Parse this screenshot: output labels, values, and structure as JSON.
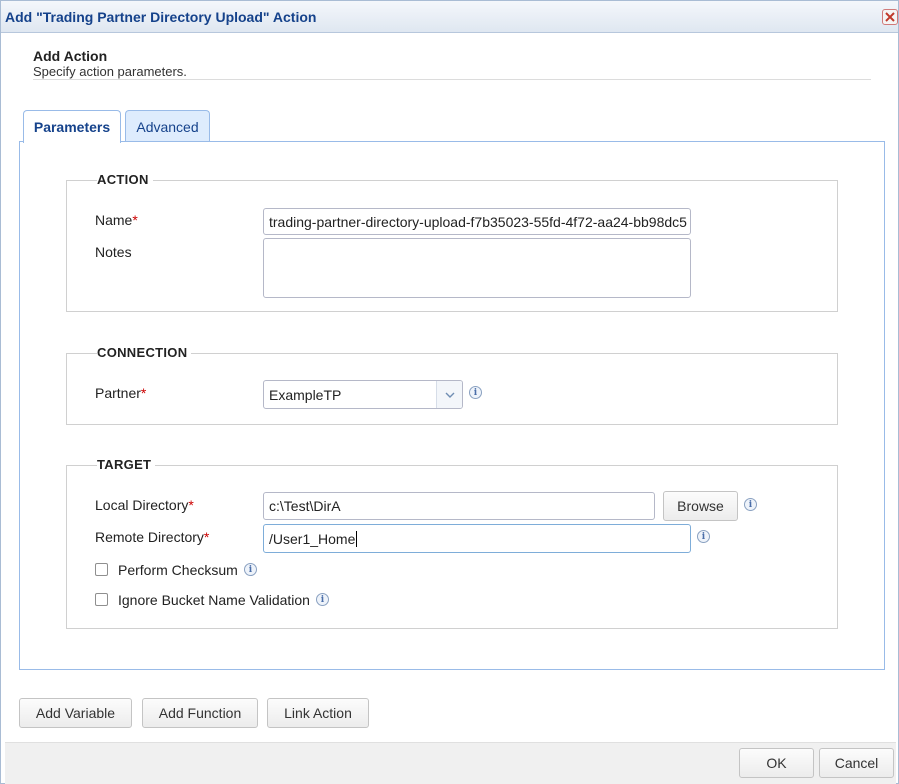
{
  "window": {
    "title": "Add \"Trading Partner Directory Upload\" Action",
    "close_label": "×"
  },
  "header": {
    "title": "Add Action",
    "subtitle": "Specify action parameters."
  },
  "tabs": [
    {
      "label": "Parameters",
      "active": true
    },
    {
      "label": "Advanced",
      "active": false
    }
  ],
  "action_group": {
    "legend": "ACTION",
    "name_label": "Name",
    "name_value": "trading-partner-directory-upload-f7b35023-55fd-4f72-aa24-bb98dc5",
    "notes_label": "Notes",
    "notes_value": ""
  },
  "connection_group": {
    "legend": "CONNECTION",
    "partner_label": "Partner",
    "partner_value": "ExampleTP"
  },
  "target_group": {
    "legend": "TARGET",
    "local_dir_label": "Local Directory",
    "local_dir_value": "c:\\Test\\DirA",
    "browse_label": "Browse",
    "remote_dir_label": "Remote Directory",
    "remote_dir_value": "/User1_Home",
    "checksum_label": "Perform Checksum",
    "checksum_checked": false,
    "ignore_bucket_label": "Ignore Bucket Name Validation",
    "ignore_bucket_checked": false
  },
  "required_marker": "*",
  "info_icon": "i",
  "bottom_buttons": {
    "add_variable": "Add Variable",
    "add_function": "Add Function",
    "link_action": "Link Action"
  },
  "footer": {
    "ok": "OK",
    "cancel": "Cancel"
  },
  "colors": {
    "title_text": "#15428b",
    "tab_border": "#99bbe8",
    "required": "#cc0000"
  }
}
